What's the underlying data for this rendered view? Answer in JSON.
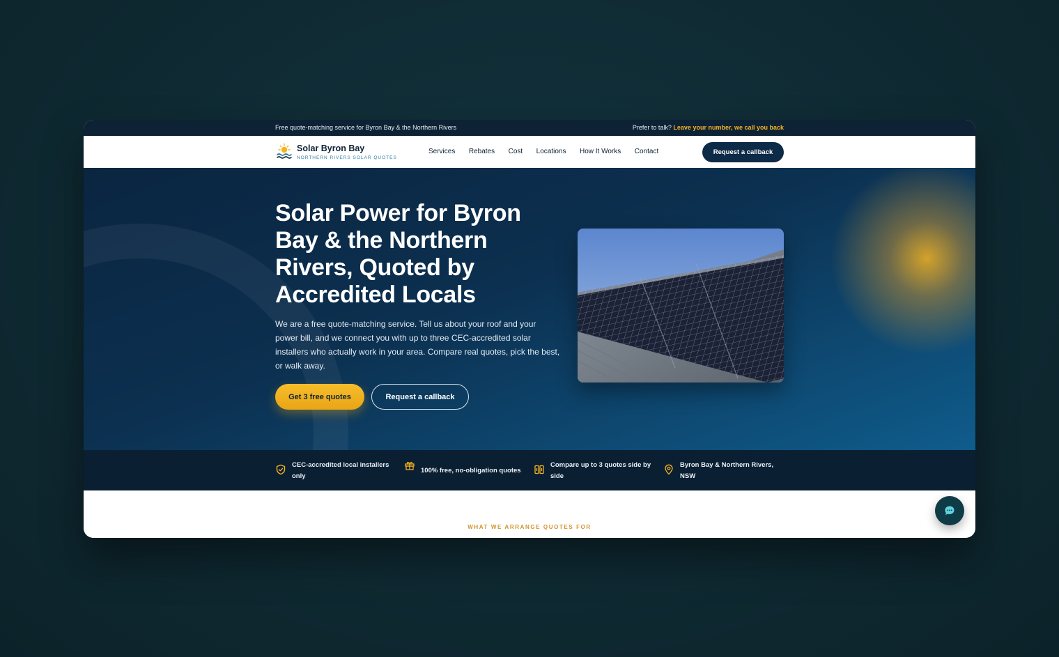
{
  "topbar": {
    "left_text": "Free quote-matching service for Byron Bay & the Northern Rivers",
    "right_prefix": "Prefer to talk?",
    "right_link": "Leave your number, we call you back"
  },
  "brand": {
    "name": "Solar Byron Bay",
    "tagline": "NORTHERN RIVERS SOLAR QUOTES",
    "logo_icon": "sun-over-waves-icon"
  },
  "nav": {
    "items": [
      "Services",
      "Rebates",
      "Cost",
      "Locations",
      "How It Works",
      "Contact"
    ],
    "cta": "Request a callback"
  },
  "hero": {
    "title": "Solar Power for Byron Bay & the Northern Rivers, Quoted by Accredited Locals",
    "body": "We are a free quote-matching service. Tell us about your roof and your power bill, and we connect you with up to three CEC-accredited solar installers who actually work in your area. Compare real quotes, pick the best, or walk away.",
    "primary_cta": "Get 3 free quotes",
    "secondary_cta": "Request a callback",
    "photo": "solar-panels-on-roof"
  },
  "trust": {
    "items": [
      {
        "icon": "shield-check-icon",
        "text": "CEC-accredited local installers only"
      },
      {
        "icon": "gift-icon",
        "text": "100% free, no-obligation quotes"
      },
      {
        "icon": "compare-columns-icon",
        "text": "Compare up to 3 quotes side by side"
      },
      {
        "icon": "map-pin-icon",
        "text": "Byron Bay & Northern Rivers, NSW"
      }
    ]
  },
  "section": {
    "eyebrow": "WHAT WE ARRANGE QUOTES FOR"
  },
  "chat": {
    "icon": "chat-bubble-icon"
  },
  "colors": {
    "navy": "#0d2235",
    "accent_gold": "#f5b320",
    "hero_blue": "#0f5c8c"
  }
}
